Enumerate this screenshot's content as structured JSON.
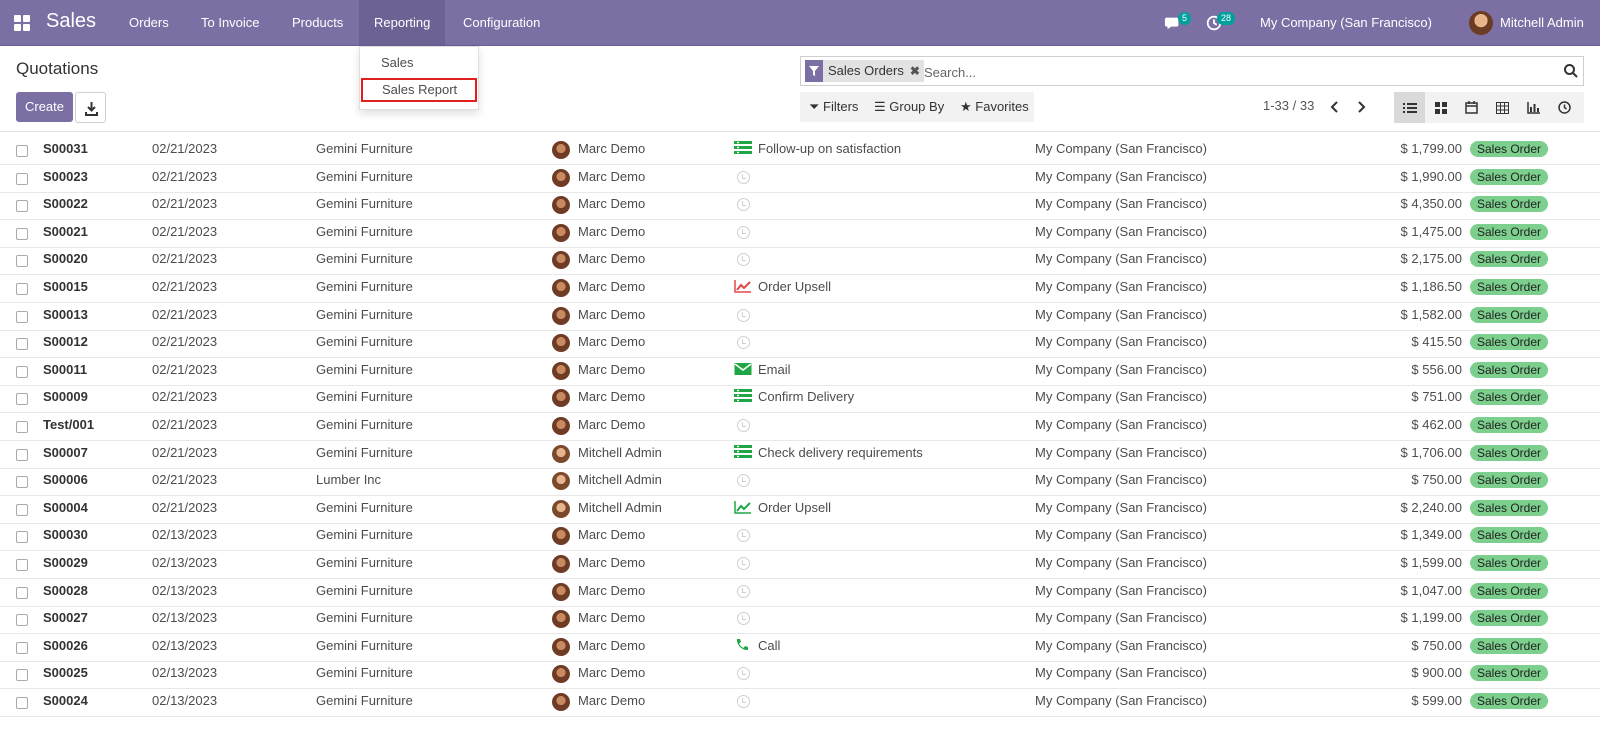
{
  "navbar": {
    "brand": "Sales",
    "menus": [
      {
        "label": "Orders"
      },
      {
        "label": "To Invoice"
      },
      {
        "label": "Products"
      },
      {
        "label": "Reporting"
      },
      {
        "label": "Configuration"
      }
    ],
    "messages_badge": "5",
    "activities_badge": "28",
    "company": "My Company (San Francisco)",
    "user": "Mitchell Admin"
  },
  "dropdown": {
    "items": [
      {
        "label": "Sales"
      },
      {
        "label": "Sales Report"
      }
    ]
  },
  "control_panel": {
    "title": "Quotations",
    "create_label": "Create",
    "facet_label": "Sales Orders",
    "search_placeholder": "Search...",
    "filters_label": "Filters",
    "groupby_label": "Group By",
    "favorites_label": "Favorites",
    "pager": "1-33 / 33"
  },
  "colors": {
    "navbar": "#7c6fa3",
    "status_badge": "#7ccf8d",
    "activity_green": "#21a645",
    "activity_red": "#e04848"
  },
  "rows": [
    {
      "number": "S00031",
      "date": "02/21/2023",
      "customer": "Gemini Furniture",
      "salesperson": "Marc Demo",
      "activity_icon": "todo-icon",
      "activity": "Follow-up on satisfaction",
      "company": "My Company (San Francisco)",
      "total": "$ 1,799.00",
      "status": "Sales Order"
    },
    {
      "number": "S00023",
      "date": "02/21/2023",
      "customer": "Gemini Furniture",
      "salesperson": "Marc Demo",
      "activity_icon": "clock-icon",
      "activity": "",
      "company": "My Company (San Francisco)",
      "total": "$ 1,990.00",
      "status": "Sales Order"
    },
    {
      "number": "S00022",
      "date": "02/21/2023",
      "customer": "Gemini Furniture",
      "salesperson": "Marc Demo",
      "activity_icon": "clock-icon",
      "activity": "",
      "company": "My Company (San Francisco)",
      "total": "$ 4,350.00",
      "status": "Sales Order"
    },
    {
      "number": "S00021",
      "date": "02/21/2023",
      "customer": "Gemini Furniture",
      "salesperson": "Marc Demo",
      "activity_icon": "clock-icon",
      "activity": "",
      "company": "My Company (San Francisco)",
      "total": "$ 1,475.00",
      "status": "Sales Order"
    },
    {
      "number": "S00020",
      "date": "02/21/2023",
      "customer": "Gemini Furniture",
      "salesperson": "Marc Demo",
      "activity_icon": "clock-icon",
      "activity": "",
      "company": "My Company (San Francisco)",
      "total": "$ 2,175.00",
      "status": "Sales Order"
    },
    {
      "number": "S00015",
      "date": "02/21/2023",
      "customer": "Gemini Furniture",
      "salesperson": "Marc Demo",
      "activity_icon": "upsell-red-icon",
      "activity": "Order Upsell",
      "company": "My Company (San Francisco)",
      "total": "$ 1,186.50",
      "status": "Sales Order"
    },
    {
      "number": "S00013",
      "date": "02/21/2023",
      "customer": "Gemini Furniture",
      "salesperson": "Marc Demo",
      "activity_icon": "clock-icon",
      "activity": "",
      "company": "My Company (San Francisco)",
      "total": "$ 1,582.00",
      "status": "Sales Order"
    },
    {
      "number": "S00012",
      "date": "02/21/2023",
      "customer": "Gemini Furniture",
      "salesperson": "Marc Demo",
      "activity_icon": "clock-icon",
      "activity": "",
      "company": "My Company (San Francisco)",
      "total": "$ 415.50",
      "status": "Sales Order"
    },
    {
      "number": "S00011",
      "date": "02/21/2023",
      "customer": "Gemini Furniture",
      "salesperson": "Marc Demo",
      "activity_icon": "email-icon",
      "activity": "Email",
      "company": "My Company (San Francisco)",
      "total": "$ 556.00",
      "status": "Sales Order"
    },
    {
      "number": "S00009",
      "date": "02/21/2023",
      "customer": "Gemini Furniture",
      "salesperson": "Marc Demo",
      "activity_icon": "todo-icon",
      "activity": "Confirm Delivery",
      "company": "My Company (San Francisco)",
      "total": "$ 751.00",
      "status": "Sales Order"
    },
    {
      "number": "Test/001",
      "date": "02/21/2023",
      "customer": "Gemini Furniture",
      "salesperson": "Marc Demo",
      "activity_icon": "clock-icon",
      "activity": "",
      "company": "My Company (San Francisco)",
      "total": "$ 462.00",
      "status": "Sales Order"
    },
    {
      "number": "S00007",
      "date": "02/21/2023",
      "customer": "Gemini Furniture",
      "salesperson": "Mitchell Admin",
      "activity_icon": "todo-icon",
      "activity": "Check delivery requirements",
      "company": "My Company (San Francisco)",
      "total": "$ 1,706.00",
      "status": "Sales Order"
    },
    {
      "number": "S00006",
      "date": "02/21/2023",
      "customer": "Lumber Inc",
      "salesperson": "Mitchell Admin",
      "activity_icon": "clock-icon",
      "activity": "",
      "company": "My Company (San Francisco)",
      "total": "$ 750.00",
      "status": "Sales Order"
    },
    {
      "number": "S00004",
      "date": "02/21/2023",
      "customer": "Gemini Furniture",
      "salesperson": "Mitchell Admin",
      "activity_icon": "upsell-green-icon",
      "activity": "Order Upsell",
      "company": "My Company (San Francisco)",
      "total": "$ 2,240.00",
      "status": "Sales Order"
    },
    {
      "number": "S00030",
      "date": "02/13/2023",
      "customer": "Gemini Furniture",
      "salesperson": "Marc Demo",
      "activity_icon": "clock-icon",
      "activity": "",
      "company": "My Company (San Francisco)",
      "total": "$ 1,349.00",
      "status": "Sales Order"
    },
    {
      "number": "S00029",
      "date": "02/13/2023",
      "customer": "Gemini Furniture",
      "salesperson": "Marc Demo",
      "activity_icon": "clock-icon",
      "activity": "",
      "company": "My Company (San Francisco)",
      "total": "$ 1,599.00",
      "status": "Sales Order"
    },
    {
      "number": "S00028",
      "date": "02/13/2023",
      "customer": "Gemini Furniture",
      "salesperson": "Marc Demo",
      "activity_icon": "clock-icon",
      "activity": "",
      "company": "My Company (San Francisco)",
      "total": "$ 1,047.00",
      "status": "Sales Order"
    },
    {
      "number": "S00027",
      "date": "02/13/2023",
      "customer": "Gemini Furniture",
      "salesperson": "Marc Demo",
      "activity_icon": "clock-icon",
      "activity": "",
      "company": "My Company (San Francisco)",
      "total": "$ 1,199.00",
      "status": "Sales Order"
    },
    {
      "number": "S00026",
      "date": "02/13/2023",
      "customer": "Gemini Furniture",
      "salesperson": "Marc Demo",
      "activity_icon": "phone-icon",
      "activity": "Call",
      "company": "My Company (San Francisco)",
      "total": "$ 750.00",
      "status": "Sales Order"
    },
    {
      "number": "S00025",
      "date": "02/13/2023",
      "customer": "Gemini Furniture",
      "salesperson": "Marc Demo",
      "activity_icon": "clock-icon",
      "activity": "",
      "company": "My Company (San Francisco)",
      "total": "$ 900.00",
      "status": "Sales Order"
    },
    {
      "number": "S00024",
      "date": "02/13/2023",
      "customer": "Gemini Furniture",
      "salesperson": "Marc Demo",
      "activity_icon": "clock-icon",
      "activity": "",
      "company": "My Company (San Francisco)",
      "total": "$ 599.00",
      "status": "Sales Order"
    }
  ]
}
